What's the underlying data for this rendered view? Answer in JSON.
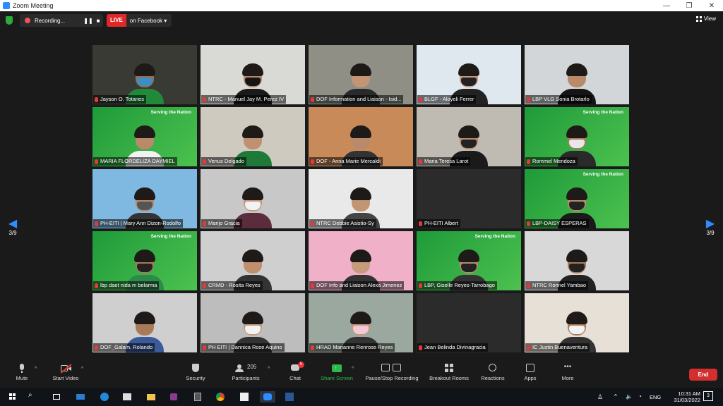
{
  "window": {
    "title": "Zoom Meeting",
    "controls": [
      "—",
      "❐",
      "✕"
    ]
  },
  "topbar": {
    "recording_label": "Recording...",
    "live_label": "LIVE",
    "live_target": "on Facebook ▾",
    "view_label": "View"
  },
  "gallery": {
    "page_left": "3/9",
    "page_right": "3/9",
    "participants": [
      {
        "name": "Jayson O. Totanes",
        "bg": "#3a3a34",
        "skin": "#9b6c4e",
        "mask": "#3c8fc2",
        "shirt": "#218a3a",
        "green": false
      },
      {
        "name": "NTRC - Manuel Jay M. Perez IV",
        "bg": "#d9d9d6",
        "skin": "#b7876a",
        "mask": "#151515",
        "shirt": "#1a1a1a",
        "green": false
      },
      {
        "name": "DOF Information and Liaison - Isid...",
        "bg": "#8f8f86",
        "skin": "#c29574",
        "mask": "",
        "shirt": "#2a2a2a",
        "green": false
      },
      {
        "name": "BLGF - Aloyeli Ferrer",
        "bg": "#dfe7ef",
        "skin": "#c79a7d",
        "mask": "#222",
        "shirt": "#222",
        "green": false
      },
      {
        "name": "LBP VLG Sonia Brotarlo",
        "bg": "#d3d6d8",
        "skin": "#b98a6a",
        "mask": "",
        "shirt": "#151515",
        "green": false
      },
      {
        "name": "MARIA FLORDELIZA DAYMIEL",
        "bg": "#2aa446",
        "skin": "#b98a6a",
        "mask": "",
        "shirt": "#f2f2f2",
        "green": true
      },
      {
        "name": "Venus Delgado",
        "bg": "#cfcac0",
        "skin": "#c09070",
        "mask": "",
        "shirt": "#1f7a3a",
        "green": false
      },
      {
        "name": "DOF - Anna Marie Mercaldi",
        "bg": "#c98a5a",
        "skin": "#b98a6a",
        "mask": "",
        "shirt": "#333",
        "green": false
      },
      {
        "name": "Maria Teresa Larot",
        "bg": "#bfbab2",
        "skin": "#b98a6a",
        "mask": "#222",
        "shirt": "#1a1a1a",
        "green": false
      },
      {
        "name": "Rommel Mendoza",
        "bg": "#2aa446",
        "skin": "#a97a5a",
        "mask": "#e8e8e8",
        "shirt": "#2a2a2a",
        "green": true
      },
      {
        "name": "PH-EITI | Mary Ann Dizon-Rodolfo",
        "bg": "#7fb8e0",
        "skin": "#b98a6a",
        "mask": "#555",
        "shirt": "#333",
        "green": false
      },
      {
        "name": "Marijo Gracia",
        "bg": "#c8c8c8",
        "skin": "#c49a7a",
        "mask": "#f2f2f2",
        "shirt": "#5a2c3c",
        "green": false
      },
      {
        "name": "NTRC Debbie Asistio-Sy",
        "bg": "#e9e9e9",
        "skin": "#c29574",
        "mask": "",
        "shirt": "#444",
        "green": false
      },
      {
        "name": "PH-EITI Albert",
        "bg": "#2b2b2b",
        "skin": "",
        "mask": "",
        "shirt": "",
        "green": false
      },
      {
        "name": "LBP-DAISY ESPERAS",
        "bg": "#2aa446",
        "skin": "#b98a6a",
        "mask": "#222",
        "shirt": "#1a1a1a",
        "green": true
      },
      {
        "name": "lbp daet nida m belarma",
        "bg": "#2aa446",
        "skin": "#a97a5a",
        "mask": "#222",
        "shirt": "#2c8a4a",
        "green": true
      },
      {
        "name": "CRMD - Rosita Reyes",
        "bg": "#cfcfcf",
        "skin": "#c0906e",
        "mask": "",
        "shirt": "#333",
        "green": false
      },
      {
        "name": "DOF Info and Liaison Alexa Jimenez",
        "bg": "#f0b0c8",
        "skin": "#c79a7d",
        "mask": "",
        "shirt": "#333",
        "green": false
      },
      {
        "name": "LBP, Giselle Reyes-Tarrobago",
        "bg": "#2aa446",
        "skin": "#b98a6a",
        "mask": "#222",
        "shirt": "#333",
        "green": true
      },
      {
        "name": "NTRC Ronnel Yambao",
        "bg": "#d8d8d8",
        "skin": "#a97a5a",
        "mask": "#222",
        "shirt": "#222",
        "green": false
      },
      {
        "name": "DOF_Galam, Rolando",
        "bg": "#cfcfcf",
        "skin": "#a97a5a",
        "mask": "",
        "shirt": "#3a5a9a",
        "green": false
      },
      {
        "name": "PH EITI | Dannica Rose Aquino",
        "bg": "#bdbdbd",
        "skin": "#c49a7a",
        "mask": "#f2f2f2",
        "shirt": "#333",
        "green": false
      },
      {
        "name": "HRAD Marianne Renrose Reyes",
        "bg": "#9aa8a0",
        "skin": "#c49a7a",
        "mask": "#f3c8d8",
        "shirt": "#333",
        "green": false
      },
      {
        "name": "Jean Belinda Divinagracia",
        "bg": "#2b2b2b",
        "skin": "",
        "mask": "",
        "shirt": "",
        "green": false
      },
      {
        "name": "IC Justin Buenaventura",
        "bg": "#e6e0d6",
        "skin": "#a97a5a",
        "mask": "#f2f2f2",
        "shirt": "#333",
        "green": false
      }
    ],
    "green_tile_caption": "Serving the Nation"
  },
  "toolbar": {
    "mute": "Mute",
    "start_video": "Start Video",
    "security": "Security",
    "participants": "Participants",
    "participants_count": "205",
    "chat": "Chat",
    "chat_badge": "5",
    "share_screen": "Share Screen",
    "pause_recording": "Pause/Stop Recording",
    "breakout_rooms": "Breakout Rooms",
    "reactions": "Reactions",
    "apps": "Apps",
    "more": "More",
    "end": "End"
  },
  "taskbar": {
    "language": "ENG",
    "time": "10:31 AM",
    "date": "31/03/2022",
    "notifications": "3"
  }
}
